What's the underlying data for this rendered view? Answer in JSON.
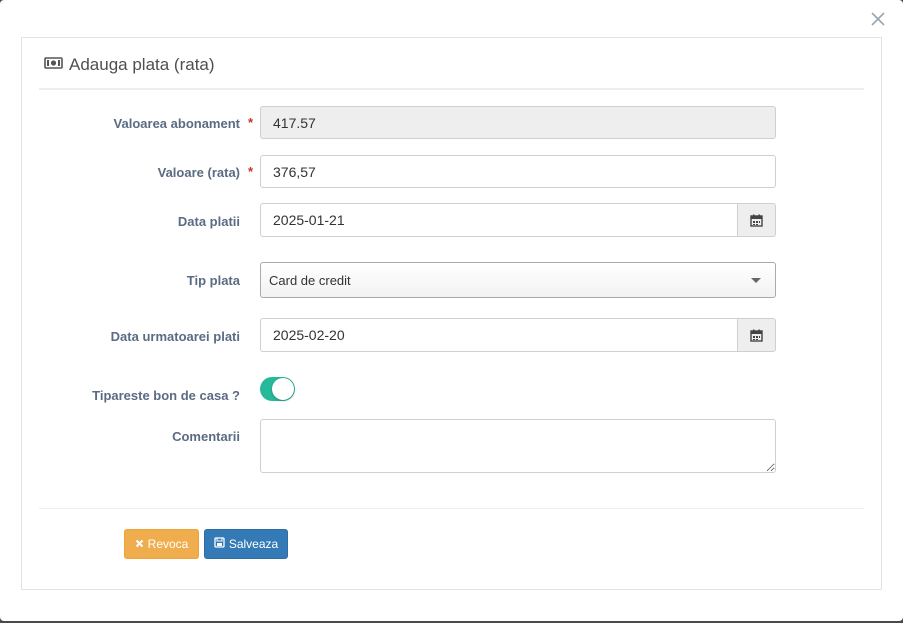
{
  "modal": {
    "title": "Adauga plata (rata)",
    "title_icon": "money-icon",
    "close_icon": "close-icon"
  },
  "form": {
    "valoarea_abonament": {
      "label": "Valoarea abonament",
      "required_mark": "*",
      "value": "417.57",
      "readonly": true
    },
    "valoare_rata": {
      "label": "Valoare (rata)",
      "required_mark": "*",
      "value": "376,57"
    },
    "data_platii": {
      "label": "Data platii",
      "value": "2025-01-21",
      "icon": "calendar-icon"
    },
    "tip_plata": {
      "label": "Tip plata",
      "selected": "Card de credit"
    },
    "data_urmatoarei_plati": {
      "label": "Data urmatoarei plati",
      "value": "2025-02-20",
      "icon": "calendar-icon"
    },
    "tipareste_bon": {
      "label": "Tipareste bon de casa ?",
      "checked": true
    },
    "comentarii": {
      "label": "Comentarii",
      "value": ""
    }
  },
  "buttons": {
    "revoca": {
      "label": "Revoca",
      "icon": "times-icon"
    },
    "salveaza": {
      "label": "Salveaza",
      "icon": "save-icon"
    }
  },
  "colors": {
    "toggle_on": "#26b99a",
    "warning": "#f0ad4e",
    "primary": "#337ab7",
    "required": "#c9302c",
    "label": "#5b6b83"
  }
}
